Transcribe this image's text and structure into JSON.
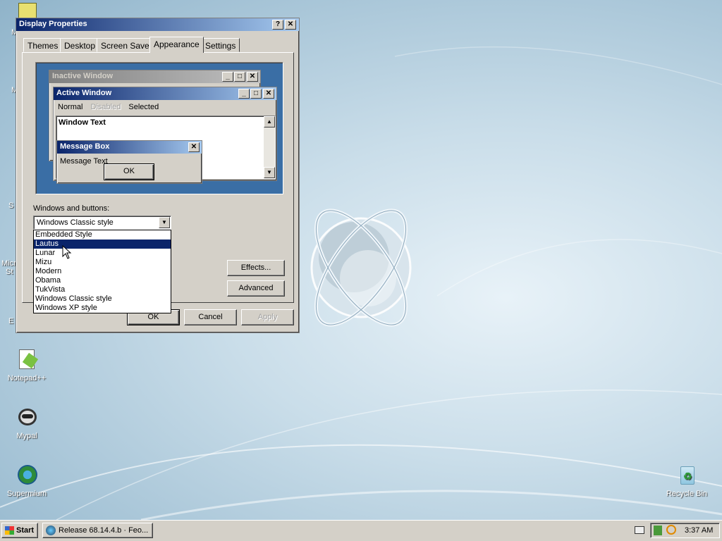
{
  "window": {
    "title": "Display Properties",
    "help_label": "?",
    "close_label": "✕",
    "tabs": [
      {
        "label": "Themes"
      },
      {
        "label": "Desktop"
      },
      {
        "label": "Screen Saver"
      },
      {
        "label": "Appearance"
      },
      {
        "label": "Settings"
      }
    ],
    "active_tab": "Appearance"
  },
  "preview": {
    "inactive_title": "Inactive Window",
    "active_title": "Active Window",
    "menu_normal": "Normal",
    "menu_disabled": "Disabled",
    "menu_selected": "Selected",
    "window_text": "Window Text",
    "msgbox_title": "Message Box",
    "msgbox_text": "Message Text",
    "msgbox_ok": "OK"
  },
  "appearance": {
    "windows_buttons_label": "Windows and buttons:",
    "selected_value": "Windows Classic style",
    "options": [
      "Embedded Style",
      "Lautus",
      "Lunar",
      "Mizu",
      "Modern",
      "Obama",
      "TukVista",
      "Windows Classic style",
      "Windows XP style"
    ],
    "highlighted_option": "Lautus",
    "effects_label": "Effects...",
    "advanced_label": "Advanced"
  },
  "buttons": {
    "ok": "OK",
    "cancel": "Cancel",
    "apply": "Apply"
  },
  "desktop_icons": {
    "notepad": "Notepad++",
    "mypal": "Mypal",
    "supermium": "Supermium",
    "recycle": "Recycle Bin",
    "partial_m1": "M",
    "partial_m2": "M",
    "partial_s": "S",
    "partial_micro": "Micr",
    "partial_st": "St",
    "partial_e": "E"
  },
  "taskbar": {
    "start_label": "Start",
    "task_label": "Release 68.14.4.b · Feo...",
    "clock": "3:37 AM"
  },
  "colors": {
    "title_active": "#0a246a",
    "title_gradient_end": "#a6caf0",
    "preview_desktop": "#3a6ea5",
    "selection": "#0a246a"
  }
}
